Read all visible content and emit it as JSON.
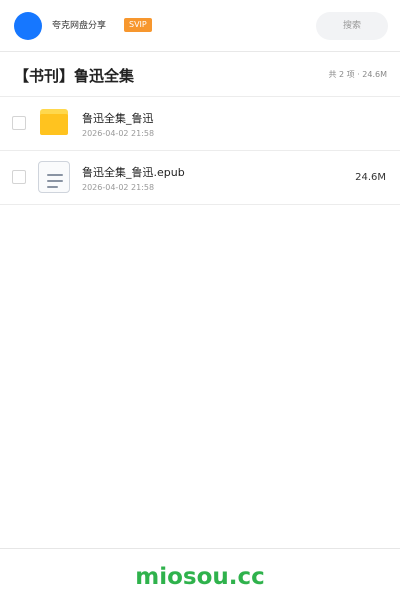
{
  "header": {
    "username": "夸克网盘分享",
    "vip_badge": "SVIP",
    "search_placeholder": "搜索"
  },
  "folder": {
    "title": "【书刊】鲁迅全集",
    "summary": "共 2 项 · 24.6M"
  },
  "files": [
    {
      "name": "鲁迅全集_鲁迅",
      "date": "2026-04-02 21:58",
      "size": "",
      "icon": "folder-icon"
    },
    {
      "name": "鲁迅全集_鲁迅.epub",
      "date": "2026-04-02 21:58",
      "size": "24.6M",
      "icon": "document-icon"
    }
  ],
  "footer": {
    "watermark": "miosou.cc"
  },
  "colors": {
    "avatar": "#1677ff",
    "vip_badge": "#f7972e",
    "folder_icon": "#ffc31f",
    "watermark": "#2fb24c"
  }
}
